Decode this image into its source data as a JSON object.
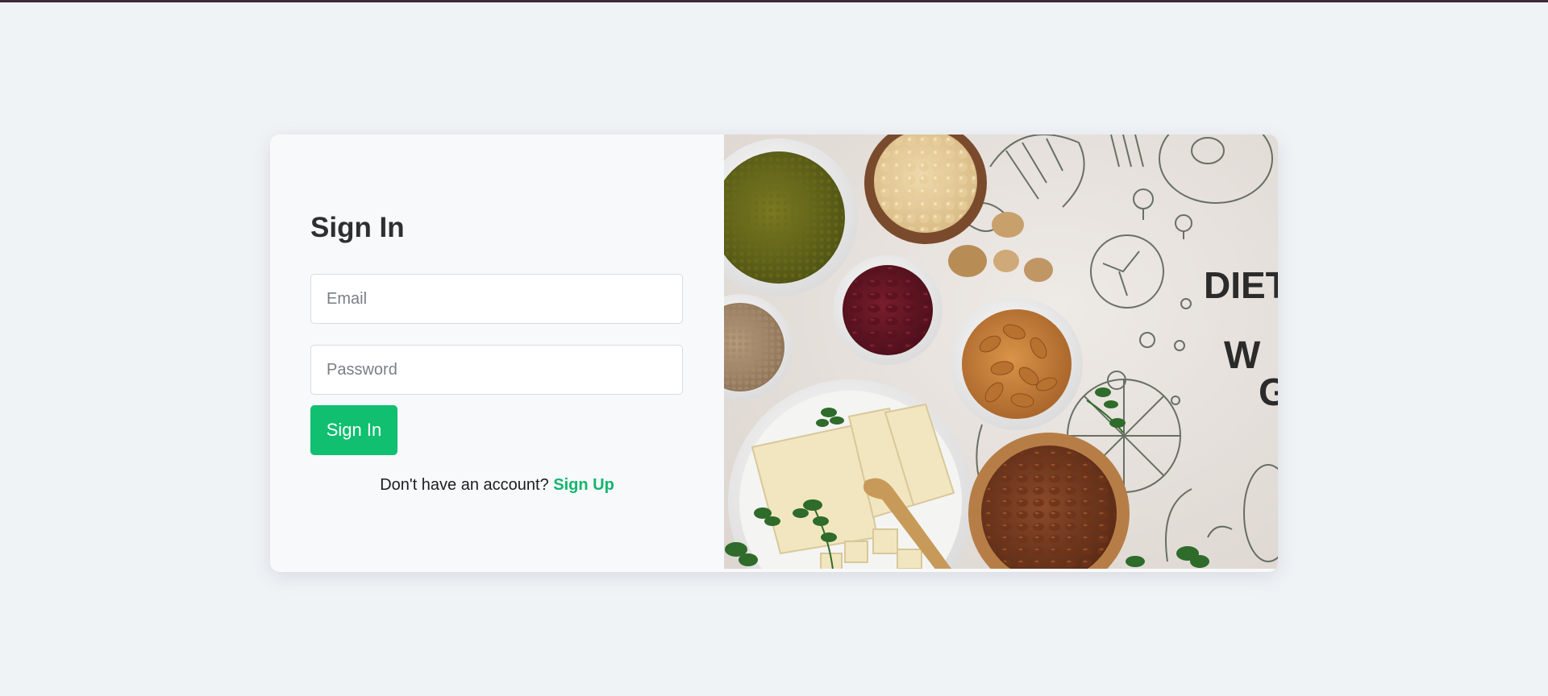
{
  "signin": {
    "title": "Sign In",
    "email_placeholder": "Email",
    "password_placeholder": "Password",
    "button_label": "Sign In",
    "account_prompt": "Don't have an account? ",
    "signup_link": "Sign Up"
  },
  "banner": {
    "line1": "DIET",
    "line2": "W",
    "line3": "G"
  },
  "colors": {
    "accent": "#10bf70",
    "link": "#13b56c",
    "background": "#f0f3f6",
    "card": "#f7f9fb",
    "topbar": "#3b2b3a"
  }
}
